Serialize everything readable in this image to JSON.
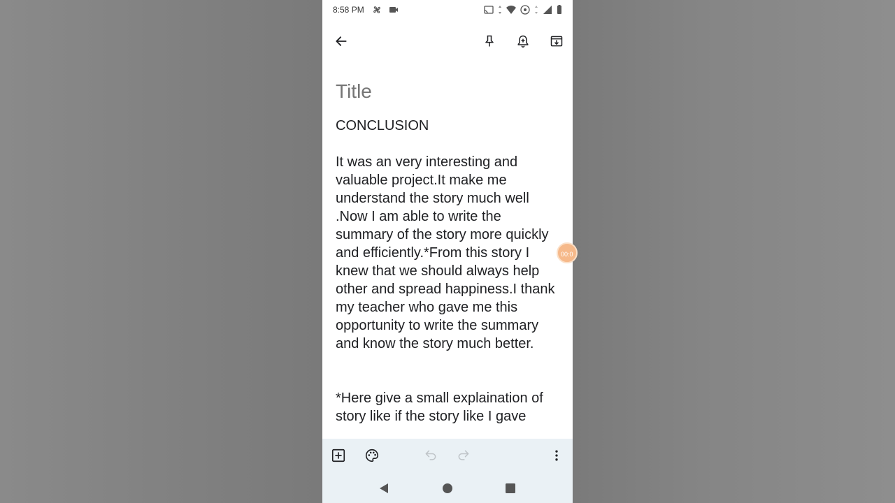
{
  "status_bar": {
    "time": "8:58 PM"
  },
  "app_bar": {
    "back_icon": "arrow-back-icon",
    "pin_icon": "pin-icon",
    "reminder_icon": "add-alert-icon",
    "archive_icon": "archive-icon"
  },
  "note": {
    "title_placeholder": "Title",
    "title_value": "",
    "body": "CONCLUSION\n\nIt was an very interesting and valuable project.It make me understand the story much well .Now I am able to write the summary of the story more quickly and efficiently.*From this story I knew that we should always help other and spread happiness.I thank my teacher who gave me this opportunity to write the summary and know the story much better.\n\n\n*Here give a small explaination of story like if the story like I gave"
  },
  "recording_bubble": {
    "text": "00:0"
  },
  "colors": {
    "toolbar_bg": "#eaf1f5",
    "text": "#202124",
    "placeholder": "#9e9e9e",
    "bubble": "#f6b98a"
  }
}
